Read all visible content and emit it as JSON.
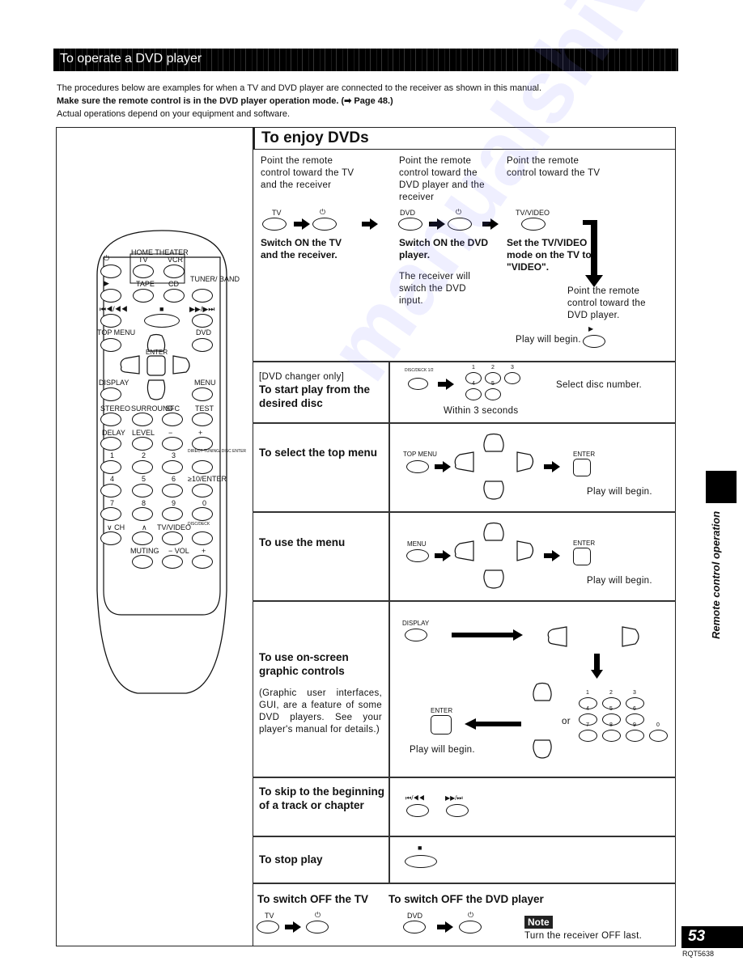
{
  "header": {
    "section_title": "To operate a DVD player",
    "intro_line1": "The procedures below are examples for when a TV and DVD player are connected to the receiver as shown in this manual.",
    "intro_line2": "Make sure the remote control is in the DVD player operation mode. (➡ Page 48.)",
    "intro_line3": "Actual operations depend on your equipment and software."
  },
  "enjoy": {
    "title": "To enjoy DVDs",
    "steps": [
      {
        "point": "Point the remote control toward the TV and the receiver",
        "btn1": "TV",
        "btn2": "⏻",
        "action": "Switch ON the TV and the receiver.",
        "note": ""
      },
      {
        "point": "Point the remote control toward the DVD player and the receiver",
        "btn1": "DVD",
        "btn2": "⏻",
        "action": "Switch ON the DVD player.",
        "note": "The receiver will switch the DVD input."
      },
      {
        "point": "Point the remote control toward the TV",
        "btn1": "TV/VIDEO",
        "action": "Set the TV/VIDEO mode on the TV to \"VIDEO\".",
        "note": "Point the remote control toward the DVD player."
      }
    ],
    "play_begin": "Play will begin.",
    "play_symbol": "▶"
  },
  "rows": [
    {
      "prefix": "[DVD changer only]",
      "label": "To start play from the desired disc",
      "button": "DISC/DECK 1/2",
      "digits": [
        "1",
        "2",
        "3",
        "4",
        "5"
      ],
      "hint": "Within 3 seconds",
      "result": "Select disc number."
    },
    {
      "label": "To select the top menu",
      "button": "TOP MENU",
      "enter": "ENTER",
      "result": "Play will begin."
    },
    {
      "label": "To use the menu",
      "button": "MENU",
      "enter": "ENTER",
      "result": "Play will begin."
    },
    {
      "label": "To use on-screen graphic controls",
      "desc": "(Graphic user interfaces, GUI, are a feature of some DVD players. See your player's manual for details.)",
      "button": "DISPLAY",
      "enter": "ENTER",
      "or": "or",
      "digits": [
        "1",
        "2",
        "3",
        "4",
        "5",
        "6",
        "7",
        "8",
        "9",
        "0"
      ],
      "result": "Play will begin."
    },
    {
      "label": "To skip to the beginning of a track or chapter",
      "btn1": "⏮/◀◀",
      "btn2": "▶▶/⏭"
    },
    {
      "label": "To stop play",
      "button": "■"
    }
  ],
  "off": {
    "tv_title": "To switch OFF the TV",
    "tv_btn1": "TV",
    "tv_btn2": "⏻",
    "dvd_title": "To switch OFF the DVD player",
    "dvd_btn1": "DVD",
    "dvd_btn2": "⏻",
    "note_badge": "Note",
    "note_text": "Turn the receiver OFF last."
  },
  "remote": {
    "home_theater": "HOME THEATER",
    "labels": [
      "⏻",
      "TV",
      "VCR",
      "▶",
      "TAPE",
      "CD",
      "TUNER/ BAND",
      "⏮◀/◀◀",
      "■",
      "▶▶/▶⏭",
      "TOP MENU",
      "DVD",
      "ENTER",
      "DISPLAY",
      "MENU",
      "STEREO",
      "SURROUND",
      "SFC",
      "TEST",
      "DELAY",
      "LEVEL",
      "−",
      "+",
      "1",
      "2",
      "3",
      "DIRECT TUNING/ DISC ENTER",
      "4",
      "5",
      "6",
      "≥10/ENTER",
      "7",
      "8",
      "9",
      "0",
      "∨ CH",
      "∧",
      "TV/VIDEO",
      "DISC/DECK",
      "MUTING",
      "− VOL",
      "+"
    ]
  },
  "sidebar": {
    "label": "Remote control operation"
  },
  "footer": {
    "page_number": "53",
    "doc_code": "RQT5638"
  },
  "watermark": "manualshive.com"
}
